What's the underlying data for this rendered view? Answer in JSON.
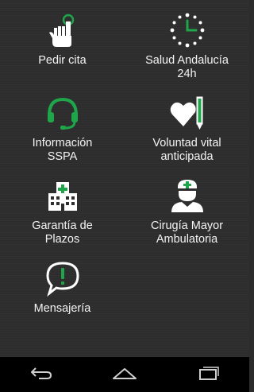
{
  "menu": {
    "items": [
      {
        "label": "Pedir cita",
        "icon": "hand-tap-icon"
      },
      {
        "label": "Salud Andalucía\n24h",
        "icon": "clock-icon"
      },
      {
        "label": "Información\nSSPA",
        "icon": "headset-icon"
      },
      {
        "label": "Voluntad vital\nanticipada",
        "icon": "heart-pen-icon"
      },
      {
        "label": "Garantía de\nPlazos",
        "icon": "hospital-icon"
      },
      {
        "label": "Cirugía Mayor\nAmbulatoria",
        "icon": "surgeon-icon"
      },
      {
        "label": "Mensajería",
        "icon": "message-alert-icon"
      }
    ]
  },
  "navbar": {
    "back": "back-icon",
    "home": "home-icon",
    "recents": "recents-icon"
  },
  "colors": {
    "accent": "#1fa64a",
    "background": "#2d2d2d",
    "text": "#f4f4f4"
  }
}
